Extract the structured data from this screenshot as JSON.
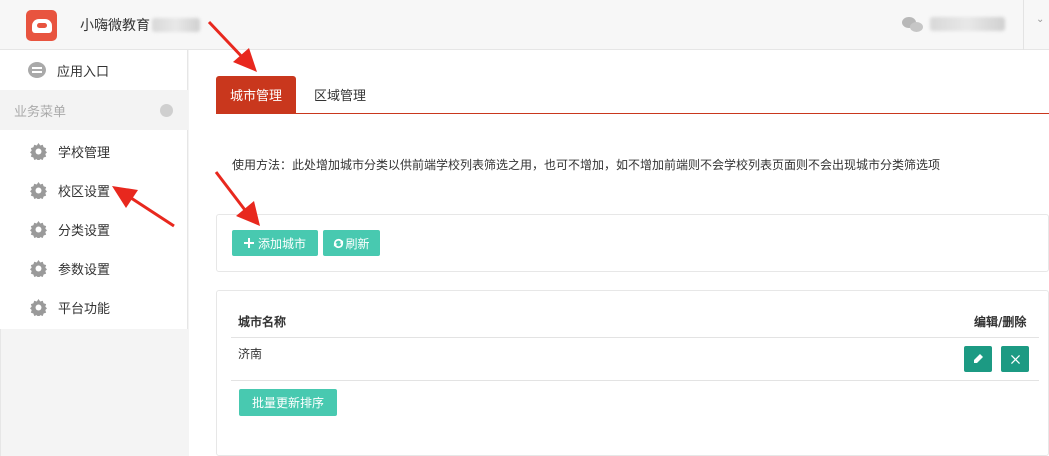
{
  "header": {
    "brand_name": "小嗨微教育"
  },
  "sidebar": {
    "entry_label": "应用入口",
    "menu_header": "业务菜单",
    "items": [
      {
        "label": "学校管理"
      },
      {
        "label": "校区设置"
      },
      {
        "label": "分类设置"
      },
      {
        "label": "参数设置"
      },
      {
        "label": "平台功能"
      }
    ]
  },
  "tabs": [
    {
      "label": "城市管理",
      "active": true
    },
    {
      "label": "区域管理",
      "active": false
    }
  ],
  "usage_text": "使用方法：此处增加城市分类以供前端学校列表筛选之用，也可不增加，如不增加前端则不会学校列表页面则不会出现城市分类筛选项",
  "toolbar": {
    "add_label": "添加城市",
    "refresh_label": "刷新"
  },
  "table": {
    "headers": [
      "城市名称",
      "编辑/删除"
    ],
    "rows": [
      {
        "name": "济南"
      }
    ]
  },
  "batch_label": "批量更新排序",
  "colors": {
    "accent": "#c9371d",
    "button": "#48c9b0",
    "button_dark": "#1c9a83",
    "annotation": "#e8281e"
  },
  "icons": [
    "logo-icon",
    "wechat-icon",
    "chat-icon",
    "gear-icon",
    "plus-icon",
    "refresh-icon",
    "pencil-icon",
    "close-icon"
  ]
}
